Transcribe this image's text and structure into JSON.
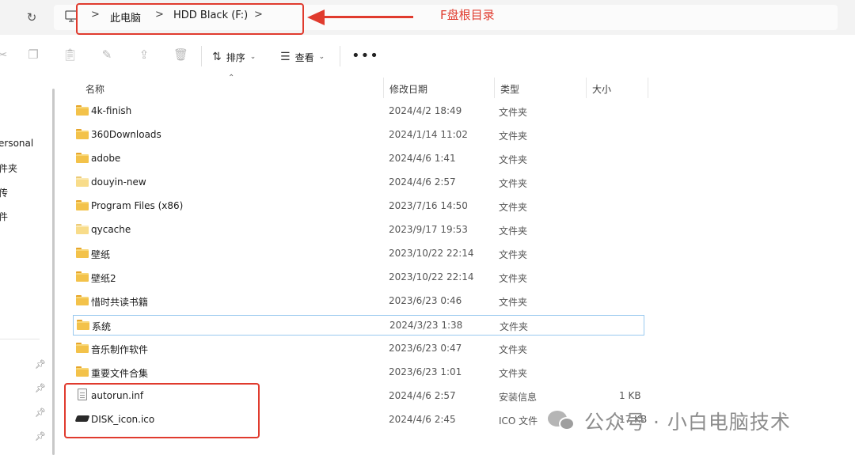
{
  "address_bar": {
    "crumbs": [
      "此电脑",
      "HDD Black (F:)"
    ],
    "separators": [
      ">",
      ">",
      ">"
    ]
  },
  "annotation": {
    "label": "F盘根目录",
    "color": "#e03b2e"
  },
  "toolbar": {
    "sort_label": "排序",
    "view_label": "查看",
    "more_label": "•••",
    "icons": [
      "cut-icon",
      "copy-icon",
      "paste-icon",
      "rename-icon",
      "share-icon",
      "delete-icon"
    ]
  },
  "nav_pane": {
    "items": [
      "ersonal",
      "件夹",
      "传",
      "件"
    ]
  },
  "columns": {
    "name": "名称",
    "date": "修改日期",
    "type": "类型",
    "size": "大小"
  },
  "files": [
    {
      "name": "4k-finish",
      "date": "2024/4/2 18:49",
      "type": "文件夹",
      "size": "",
      "icon": "folder-icon"
    },
    {
      "name": "360Downloads",
      "date": "2024/1/14 11:02",
      "type": "文件夹",
      "size": "",
      "icon": "folder-icon"
    },
    {
      "name": "adobe",
      "date": "2024/4/6 1:41",
      "type": "文件夹",
      "size": "",
      "icon": "folder-icon"
    },
    {
      "name": "douyin-new",
      "date": "2024/4/6 2:57",
      "type": "文件夹",
      "size": "",
      "icon": "folder-light-icon"
    },
    {
      "name": "Program Files (x86)",
      "date": "2023/7/16 14:50",
      "type": "文件夹",
      "size": "",
      "icon": "folder-icon"
    },
    {
      "name": "qycache",
      "date": "2023/9/17 19:53",
      "type": "文件夹",
      "size": "",
      "icon": "folder-light-icon"
    },
    {
      "name": "壁纸",
      "date": "2023/10/22 22:14",
      "type": "文件夹",
      "size": "",
      "icon": "folder-icon"
    },
    {
      "name": "壁纸2",
      "date": "2023/10/22 22:14",
      "type": "文件夹",
      "size": "",
      "icon": "folder-icon"
    },
    {
      "name": "惜时共读书籍",
      "date": "2023/6/23 0:46",
      "type": "文件夹",
      "size": "",
      "icon": "folder-icon"
    },
    {
      "name": "系统",
      "date": "2024/3/23 1:38",
      "type": "文件夹",
      "size": "",
      "icon": "folder-icon"
    },
    {
      "name": "音乐制作软件",
      "date": "2023/6/23 0:47",
      "type": "文件夹",
      "size": "",
      "icon": "folder-icon"
    },
    {
      "name": "重要文件合集",
      "date": "2023/6/23 1:01",
      "type": "文件夹",
      "size": "",
      "icon": "folder-icon"
    },
    {
      "name": "autorun.inf",
      "date": "2024/4/6 2:57",
      "type": "安装信息",
      "size": "1 KB",
      "icon": "document-icon"
    },
    {
      "name": "DISK_icon.ico",
      "date": "2024/4/6 2:45",
      "type": "ICO 文件",
      "size": "17 KB",
      "icon": "ico-file-icon"
    }
  ],
  "watermark": {
    "text": "公众号 · 小白电脑技术"
  }
}
